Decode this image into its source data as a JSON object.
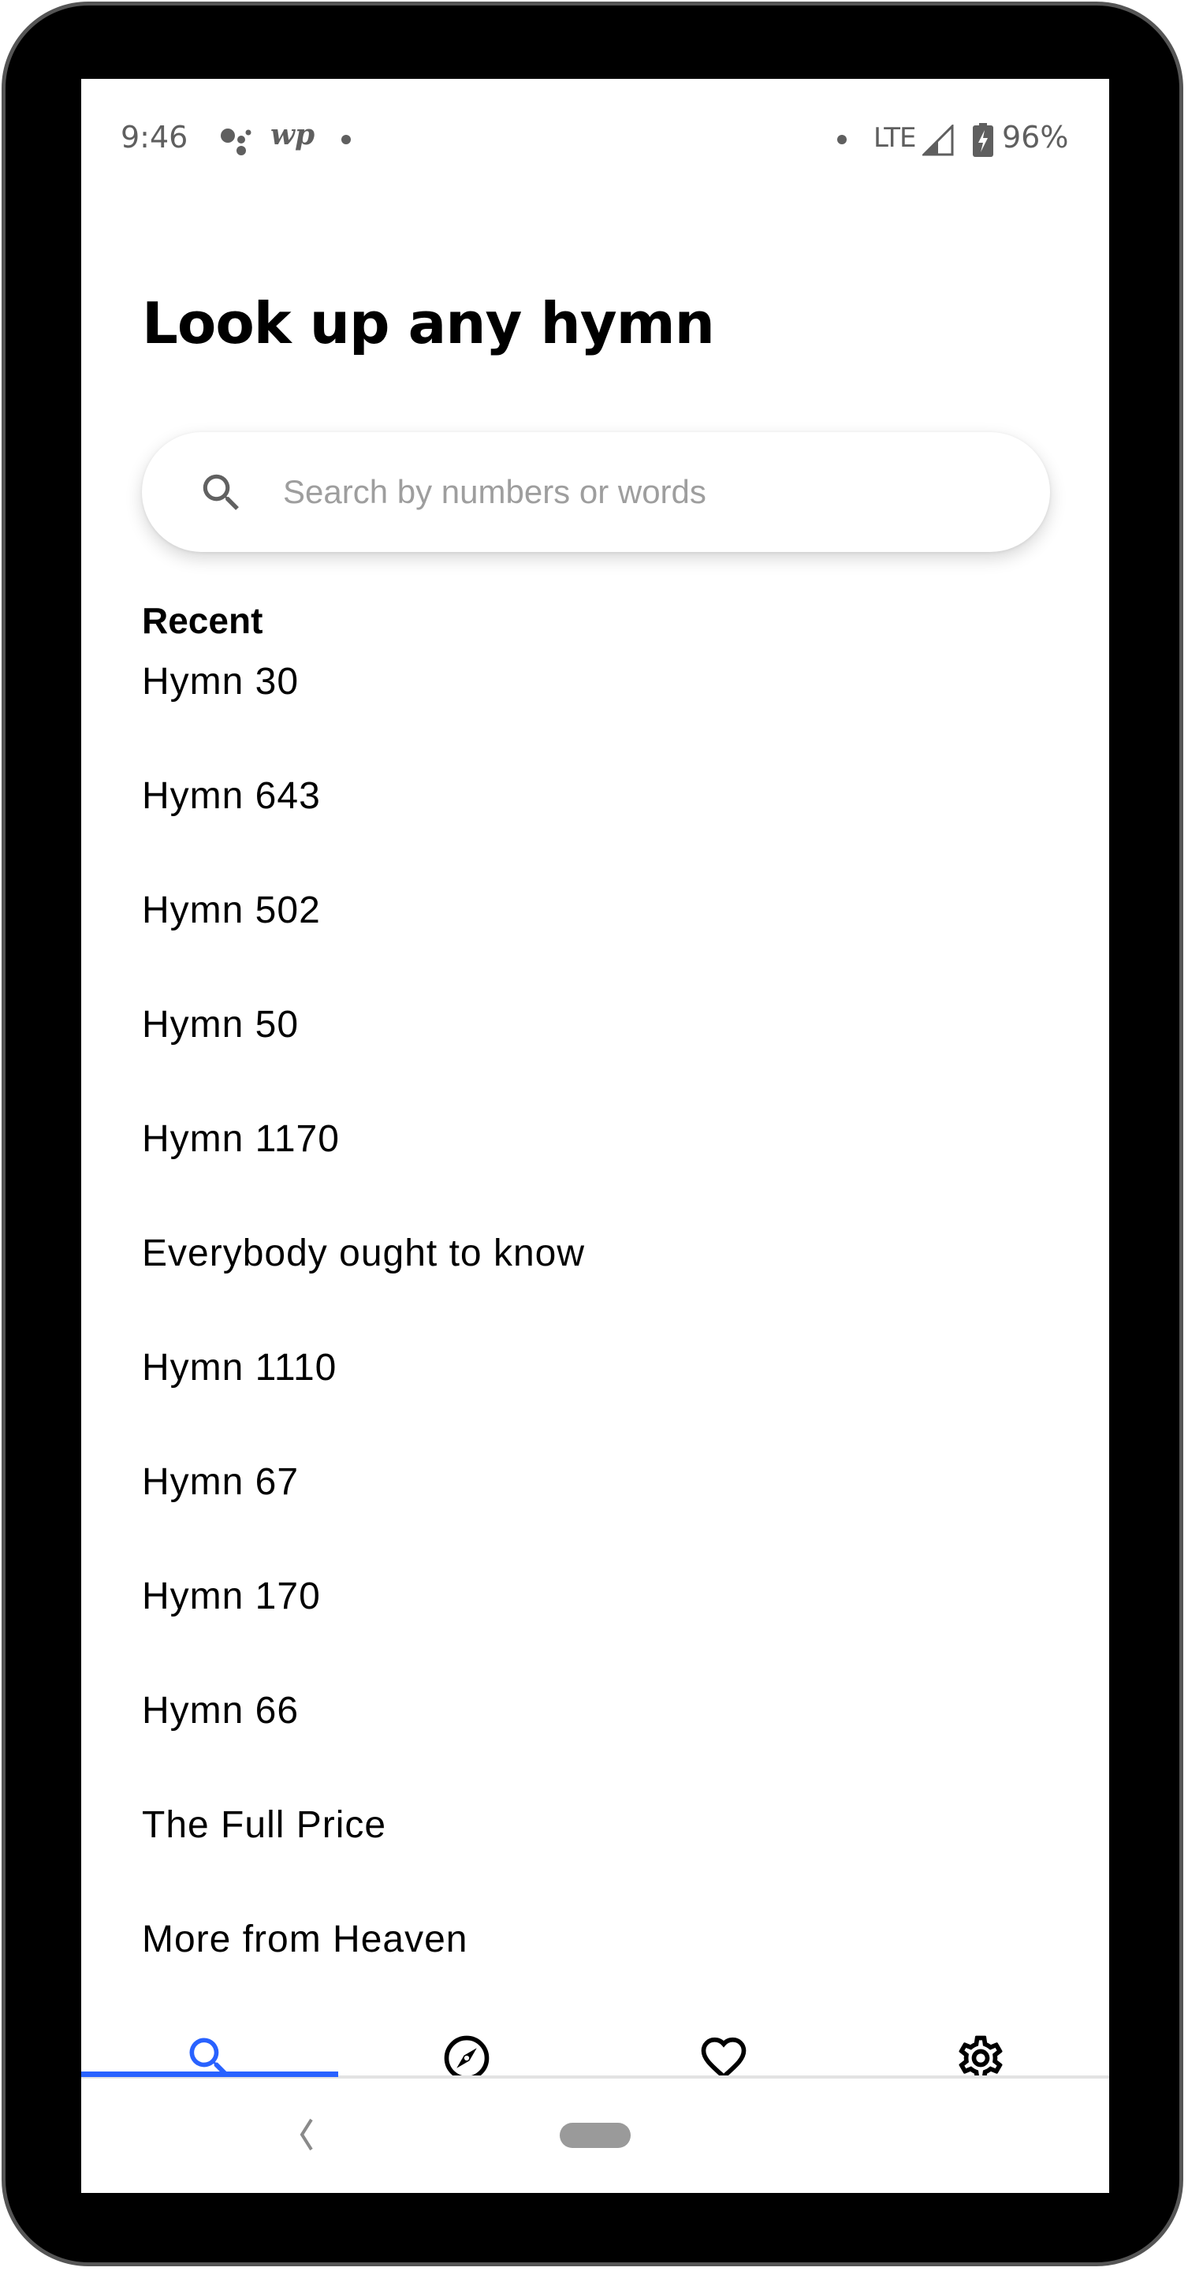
{
  "status_bar": {
    "time": "9:46",
    "notification_icons": [
      "google-assistant-icon",
      "washington-post-icon",
      "dot-icon"
    ],
    "wp_label": "wp",
    "network": "LTE",
    "battery_percent": "96%",
    "battery_charging": true
  },
  "header": {
    "title": "Look up any hymn"
  },
  "search": {
    "placeholder": "Search by numbers or words",
    "value": ""
  },
  "recent": {
    "label": "Recent",
    "items": [
      "Hymn 30",
      "Hymn 643",
      "Hymn 502",
      "Hymn 50",
      "Hymn 1170",
      "Everybody ought to know",
      "Hymn 1110",
      "Hymn 67",
      "Hymn 170",
      "Hymn 66",
      "The Full Price",
      "More from Heaven"
    ]
  },
  "bottom_nav": {
    "tabs": [
      {
        "name": "search",
        "icon": "search-icon",
        "active": true
      },
      {
        "name": "explore",
        "icon": "compass-icon",
        "active": false
      },
      {
        "name": "favorites",
        "icon": "heart-icon",
        "active": false
      },
      {
        "name": "settings",
        "icon": "gear-icon",
        "active": false
      }
    ]
  },
  "colors": {
    "accent": "#2962ff",
    "text": "#000000",
    "placeholder": "#9e9e9e",
    "status_icons": "#5f5f5f"
  }
}
